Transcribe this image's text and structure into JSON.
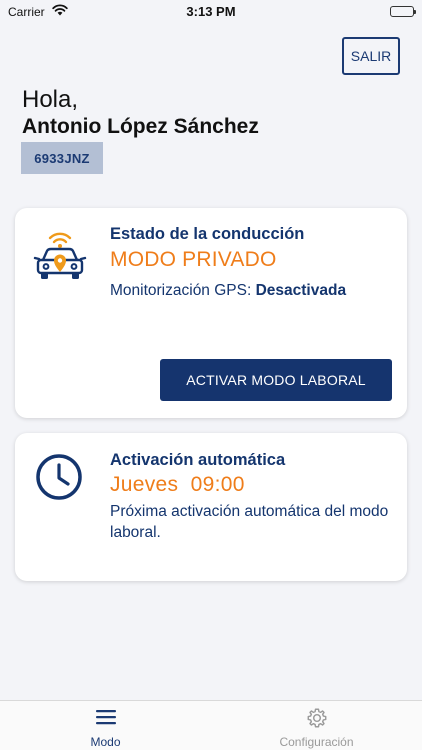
{
  "status_bar": {
    "carrier": "Carrier",
    "time": "3:13 PM"
  },
  "header": {
    "logout_label": "SALIR",
    "greeting": "Hola,",
    "user_name": "Antonio López Sánchez",
    "plate": "6933JNZ"
  },
  "driving_card": {
    "title": "Estado de la conducción",
    "mode": "MODO PRIVADO",
    "gps_label": "Monitorización GPS: ",
    "gps_value": "Desactivada",
    "action_label": "ACTIVAR MODO LABORAL",
    "icon": "car-signal-icon"
  },
  "auto_card": {
    "title": "Activación automática",
    "day": "Jueves",
    "time": "09:00",
    "description": "Próxima activación automática del modo laboral.",
    "icon": "clock-icon"
  },
  "tab_bar": {
    "tabs": [
      {
        "label": "Modo",
        "icon": "menu-icon",
        "active": true
      },
      {
        "label": "Configuración",
        "icon": "gear-icon",
        "active": false
      }
    ]
  },
  "colors": {
    "primary": "#15346e",
    "accent": "#ef7d1a",
    "background": "#f3f4f8",
    "plate_bg": "#b3bfd4",
    "inactive": "#9a9a9a"
  }
}
